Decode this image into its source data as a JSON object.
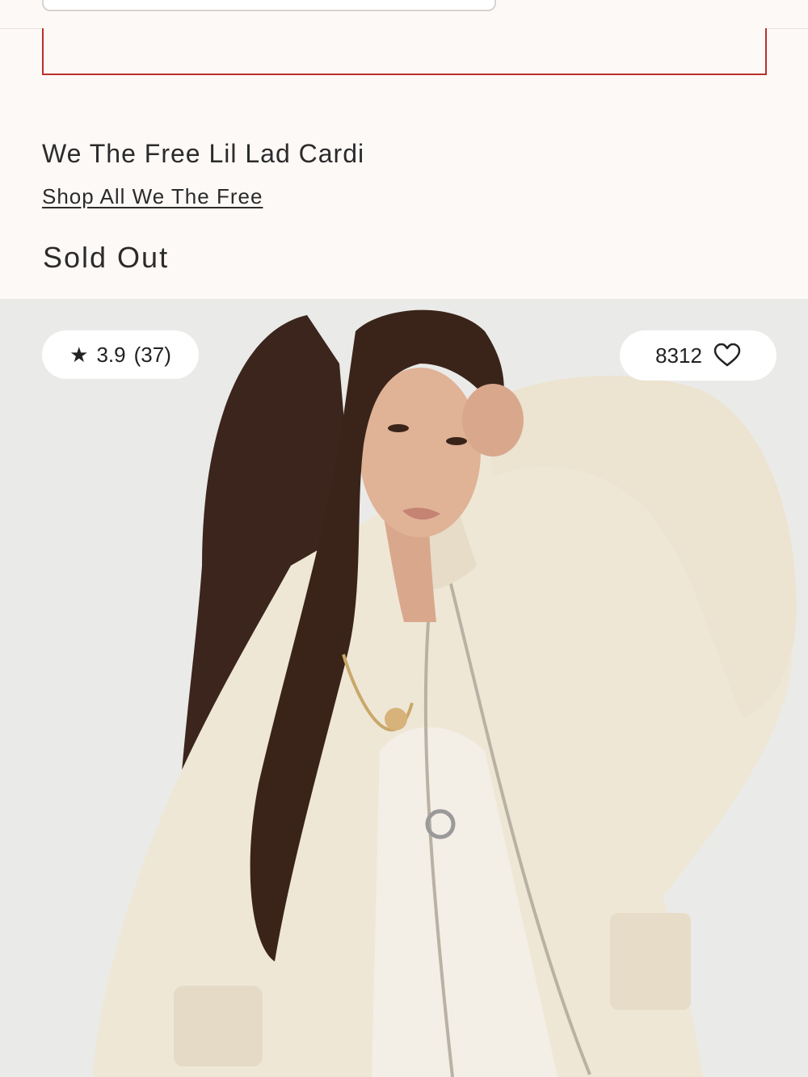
{
  "product": {
    "title": "We The Free Lil Lad Cardi",
    "brand_link": "Shop All We The Free",
    "availability": "Sold Out"
  },
  "image": {
    "rating": "3.9",
    "review_count": "(37)",
    "favorites_count": "8312"
  },
  "icons": {
    "rating": "star-icon",
    "favorite": "heart-icon"
  },
  "colors": {
    "background": "#fdf9f7",
    "alert_border": "#b8322a",
    "text": "#2b2b2b",
    "photo_bg": "#e9e9e7"
  }
}
